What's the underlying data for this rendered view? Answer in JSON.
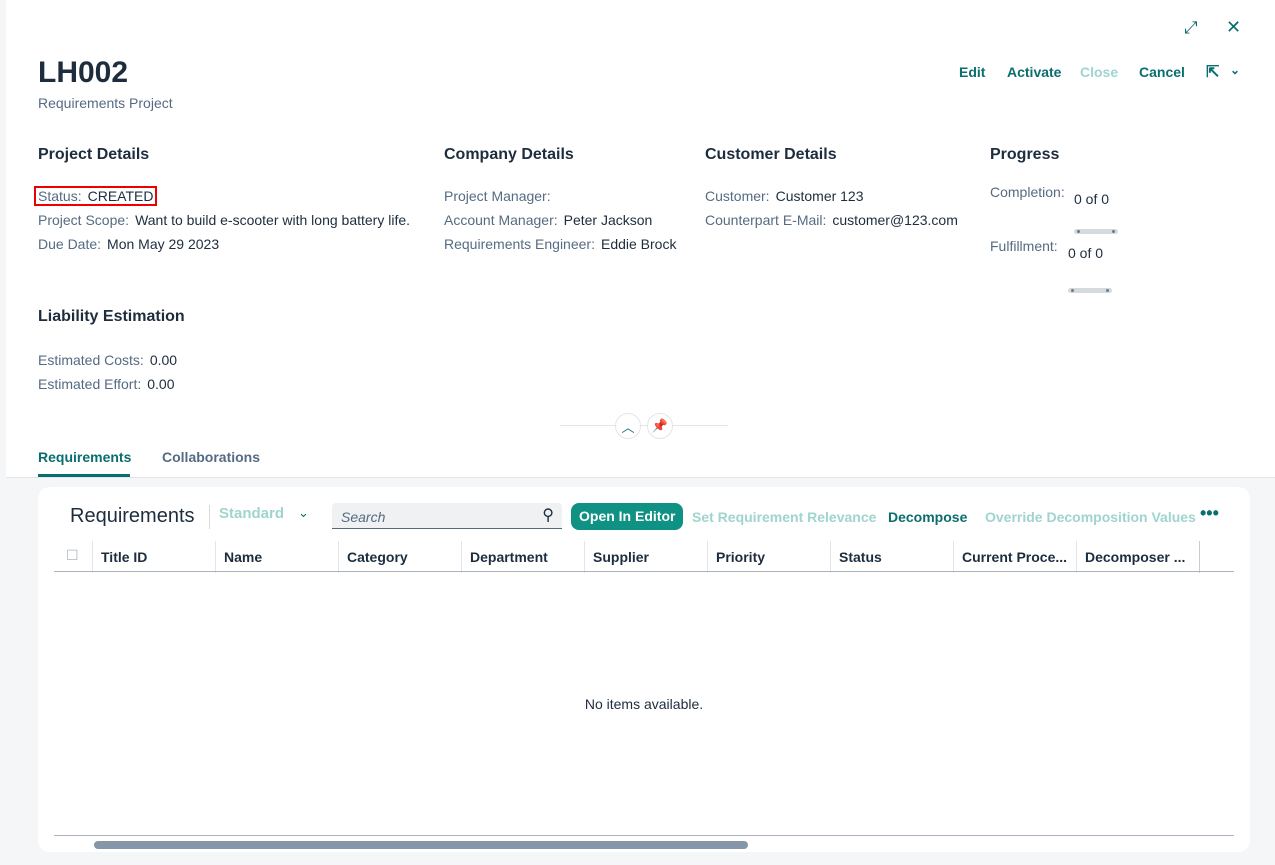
{
  "header": {
    "title": "LH002",
    "subtitle": "Requirements Project",
    "actions": {
      "edit": "Edit",
      "activate": "Activate",
      "close": "Close",
      "cancel": "Cancel"
    }
  },
  "project_details": {
    "heading": "Project Details",
    "status_label": "Status:",
    "status_value": "CREATED",
    "scope_label": "Project Scope:",
    "scope_value": "Want to build e-scooter with long battery life.",
    "due_label": "Due Date:",
    "due_value": "Mon May 29 2023"
  },
  "company_details": {
    "heading": "Company Details",
    "pm_label": "Project Manager:",
    "pm_value": "",
    "am_label": "Account Manager:",
    "am_value": "Peter Jackson",
    "re_label": "Requirements Engineer:",
    "re_value": "Eddie Brock"
  },
  "customer_details": {
    "heading": "Customer Details",
    "customer_label": "Customer:",
    "customer_value": "Customer 123",
    "email_label": "Counterpart E-Mail:",
    "email_value": "customer@123.com"
  },
  "progress": {
    "heading": "Progress",
    "completion_label": "Completion:",
    "completion_value": "0 of 0",
    "completion_fraction": 0,
    "fulfillment_label": "Fulfillment:",
    "fulfillment_value": "0 of 0",
    "fulfillment_fraction": 0
  },
  "liability": {
    "heading": "Liability Estimation",
    "costs_label": "Estimated Costs:",
    "costs_value": "0.00",
    "effort_label": "Estimated Effort:",
    "effort_value": "0.00"
  },
  "tabs": [
    {
      "label": "Requirements",
      "selected": true
    },
    {
      "label": "Collaborations",
      "selected": false
    }
  ],
  "table": {
    "title": "Requirements",
    "variant": "Standard",
    "search_placeholder": "Search",
    "buttons": {
      "open_editor": "Open In Editor",
      "set_relevance": "Set Requirement Relevance",
      "decompose": "Decompose",
      "override": "Override Decomposition Values"
    },
    "columns": [
      "Title ID",
      "Name",
      "Category",
      "Department",
      "Supplier",
      "Priority",
      "Status",
      "Current Proce...",
      "Decomposer ..."
    ],
    "empty_text": "No items available."
  },
  "colors": {
    "accent": "#0a6e6e",
    "button": "#0f9183",
    "highlight": "#e00000"
  }
}
